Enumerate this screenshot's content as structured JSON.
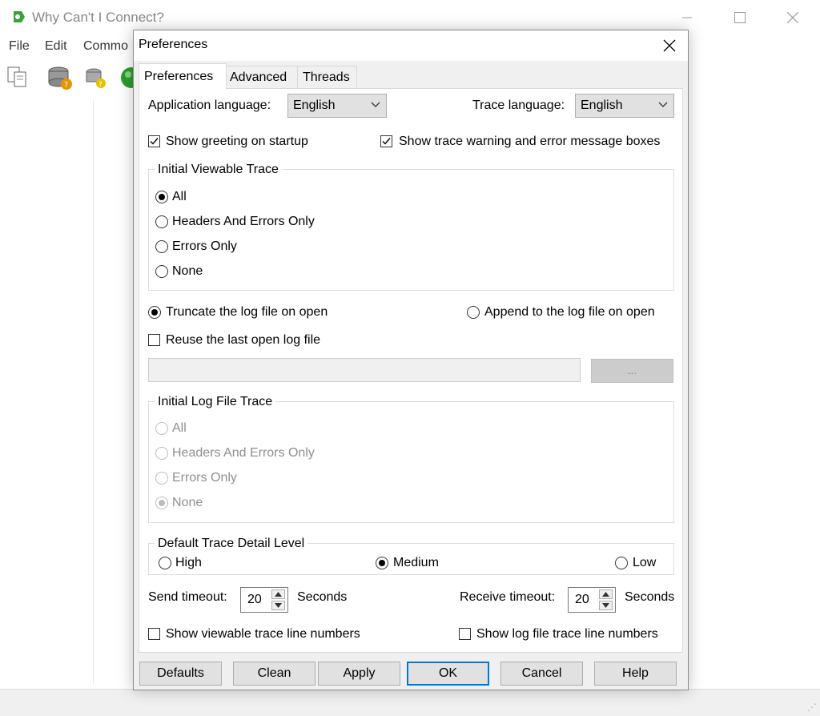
{
  "main_window": {
    "title": "Why Can't I Connect?",
    "menu": [
      "File",
      "Edit",
      "Commo"
    ],
    "toolbar_icons": [
      "copy-icon",
      "database-help-icon",
      "database-query-icon",
      "globe-icon"
    ]
  },
  "dialog": {
    "title": "Preferences",
    "tabs": [
      "Preferences",
      "Advanced",
      "Threads"
    ],
    "app_language_label": "Application language:",
    "app_language_value": "English",
    "trace_language_label": "Trace language:",
    "trace_language_value": "English",
    "show_greeting_label": "Show greeting on startup",
    "show_greeting_checked": true,
    "show_trace_warning_label": "Show trace warning and error message boxes",
    "show_trace_warning_checked": true,
    "viewable_trace": {
      "title": "Initial Viewable Trace",
      "options": [
        "All",
        "Headers And Errors Only",
        "Errors Only",
        "None"
      ],
      "selected": "All"
    },
    "truncate_label": "Truncate the log file on open",
    "append_label": "Append to the log file on open",
    "log_mode_selected": "truncate",
    "reuse_label": "Reuse the last open log file",
    "reuse_checked": false,
    "log_path_value": "",
    "browse_label": "...",
    "log_file_trace": {
      "title": "Initial Log File Trace",
      "options": [
        "All",
        "Headers And Errors Only",
        "Errors Only",
        "None"
      ],
      "selected": "None",
      "enabled": false
    },
    "detail_level": {
      "title": "Default Trace Detail Level",
      "options": [
        "High",
        "Medium",
        "Low"
      ],
      "selected": "Medium"
    },
    "send_timeout_label": "Send timeout:",
    "send_timeout_value": "20",
    "send_timeout_unit": "Seconds",
    "receive_timeout_label": "Receive timeout:",
    "receive_timeout_value": "20",
    "receive_timeout_unit": "Seconds",
    "show_viewable_line_numbers_label": "Show viewable trace line numbers",
    "show_log_line_numbers_label": "Show log file trace line numbers",
    "buttons": {
      "defaults": "Defaults",
      "clean": "Clean",
      "apply": "Apply",
      "ok": "OK",
      "cancel": "Cancel",
      "help": "Help"
    }
  },
  "colors": {
    "dialog_bg": "#f0f0f0",
    "focus_border": "#0078d7",
    "disabled_text": "#8f8f8f"
  }
}
